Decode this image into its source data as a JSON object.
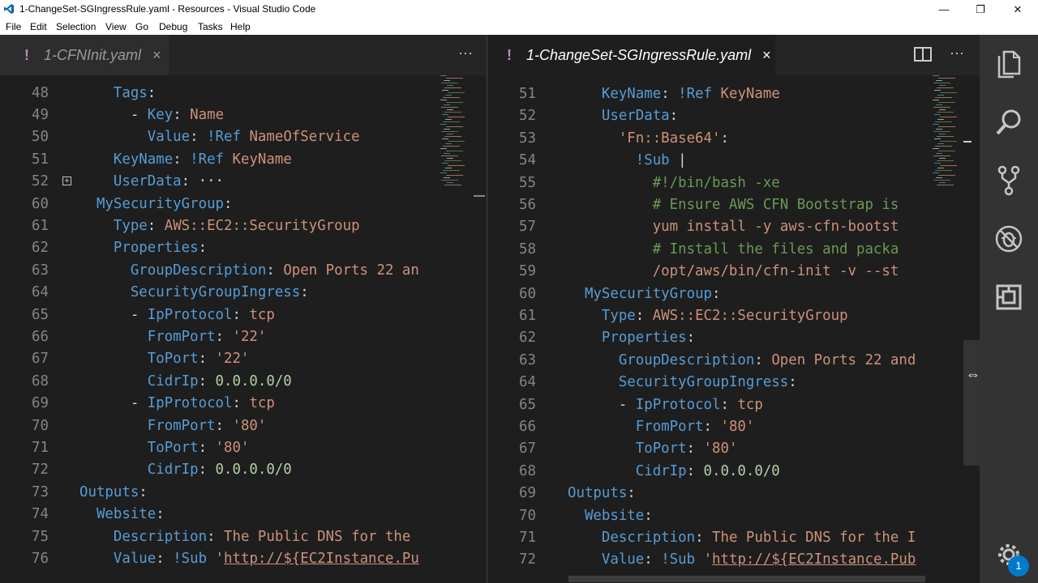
{
  "window": {
    "title": "1-ChangeSet-SGIngressRule.yaml - Resources - Visual Studio Code",
    "minimize": "—",
    "restore": "❐",
    "close": "✕"
  },
  "menu": [
    "File",
    "Edit",
    "Selection",
    "View",
    "Go",
    "Debug",
    "Tasks",
    "Help"
  ],
  "left": {
    "tab": {
      "mod": "!",
      "label": "1-CFNInit.yaml",
      "close": "×"
    },
    "more": "···",
    "lines": [
      {
        "n": "48",
        "t": [
          [
            "    ",
            "p"
          ],
          [
            "Tags",
            "k"
          ],
          [
            ":",
            "p"
          ]
        ]
      },
      {
        "n": "49",
        "t": [
          [
            "      ",
            "p"
          ],
          [
            "- ",
            "p"
          ],
          [
            "Key",
            "k"
          ],
          [
            ": ",
            "p"
          ],
          [
            "Name",
            "s"
          ]
        ]
      },
      {
        "n": "50",
        "t": [
          [
            "        ",
            "p"
          ],
          [
            "Value",
            "k"
          ],
          [
            ": ",
            "p"
          ],
          [
            "!Ref",
            "k"
          ],
          [
            " NameOfService",
            "s"
          ]
        ]
      },
      {
        "n": "51",
        "t": [
          [
            "    ",
            "p"
          ],
          [
            "KeyName",
            "k"
          ],
          [
            ": ",
            "p"
          ],
          [
            "!Ref",
            "k"
          ],
          [
            " KeyName",
            "s"
          ]
        ]
      },
      {
        "n": "52",
        "t": [
          [
            "    ",
            "p"
          ],
          [
            "UserData",
            "k"
          ],
          [
            ":",
            "p"
          ],
          [
            " ···",
            "p"
          ]
        ]
      },
      {
        "n": "60",
        "t": [
          [
            "  ",
            "p"
          ],
          [
            "MySecurityGroup",
            "k"
          ],
          [
            ":",
            "p"
          ]
        ]
      },
      {
        "n": "61",
        "t": [
          [
            "    ",
            "p"
          ],
          [
            "Type",
            "k"
          ],
          [
            ": ",
            "p"
          ],
          [
            "AWS::EC2::SecurityGroup",
            "s"
          ]
        ]
      },
      {
        "n": "62",
        "t": [
          [
            "    ",
            "p"
          ],
          [
            "Properties",
            "k"
          ],
          [
            ":",
            "p"
          ]
        ]
      },
      {
        "n": "63",
        "t": [
          [
            "      ",
            "p"
          ],
          [
            "GroupDescription",
            "k"
          ],
          [
            ": ",
            "p"
          ],
          [
            "Open Ports 22 an",
            "s"
          ]
        ]
      },
      {
        "n": "64",
        "t": [
          [
            "      ",
            "p"
          ],
          [
            "SecurityGroupIngress",
            "k"
          ],
          [
            ":",
            "p"
          ]
        ]
      },
      {
        "n": "65",
        "t": [
          [
            "      ",
            "p"
          ],
          [
            "- ",
            "p"
          ],
          [
            "IpProtocol",
            "k"
          ],
          [
            ": ",
            "p"
          ],
          [
            "tcp",
            "s"
          ]
        ]
      },
      {
        "n": "66",
        "t": [
          [
            "        ",
            "p"
          ],
          [
            "FromPort",
            "k"
          ],
          [
            ": ",
            "p"
          ],
          [
            "'22'",
            "s"
          ]
        ]
      },
      {
        "n": "67",
        "t": [
          [
            "        ",
            "p"
          ],
          [
            "ToPort",
            "k"
          ],
          [
            ": ",
            "p"
          ],
          [
            "'22'",
            "s"
          ]
        ]
      },
      {
        "n": "68",
        "t": [
          [
            "        ",
            "p"
          ],
          [
            "CidrIp",
            "k"
          ],
          [
            ": ",
            "p"
          ],
          [
            "0.0.0.0/0",
            "n"
          ]
        ]
      },
      {
        "n": "69",
        "t": [
          [
            "      ",
            "p"
          ],
          [
            "- ",
            "p"
          ],
          [
            "IpProtocol",
            "k"
          ],
          [
            ": ",
            "p"
          ],
          [
            "tcp",
            "s"
          ]
        ]
      },
      {
        "n": "70",
        "t": [
          [
            "        ",
            "p"
          ],
          [
            "FromPort",
            "k"
          ],
          [
            ": ",
            "p"
          ],
          [
            "'80'",
            "s"
          ]
        ]
      },
      {
        "n": "71",
        "t": [
          [
            "        ",
            "p"
          ],
          [
            "ToPort",
            "k"
          ],
          [
            ": ",
            "p"
          ],
          [
            "'80'",
            "s"
          ]
        ]
      },
      {
        "n": "72",
        "t": [
          [
            "        ",
            "p"
          ],
          [
            "CidrIp",
            "k"
          ],
          [
            ": ",
            "p"
          ],
          [
            "0.0.0.0/0",
            "n"
          ]
        ]
      },
      {
        "n": "73",
        "t": [
          [
            "",
            "p"
          ],
          [
            "Outputs",
            "k"
          ],
          [
            ":",
            "p"
          ]
        ]
      },
      {
        "n": "74",
        "t": [
          [
            "  ",
            "p"
          ],
          [
            "Website",
            "k"
          ],
          [
            ":",
            "p"
          ]
        ]
      },
      {
        "n": "75",
        "t": [
          [
            "    ",
            "p"
          ],
          [
            "Description",
            "k"
          ],
          [
            ": ",
            "p"
          ],
          [
            "The Public DNS for the",
            "s"
          ]
        ]
      },
      {
        "n": "76",
        "t": [
          [
            "    ",
            "p"
          ],
          [
            "Value",
            "k"
          ],
          [
            ": ",
            "p"
          ],
          [
            "!Sub",
            "k"
          ],
          [
            " '",
            "s"
          ],
          [
            "http://${EC2Instance.Pu",
            "u"
          ]
        ]
      }
    ]
  },
  "right": {
    "tab": {
      "mod": "!",
      "label": "1-ChangeSet-SGIngressRule.yaml",
      "close": "×"
    },
    "more": "···",
    "lines": [
      {
        "n": "51",
        "t": [
          [
            "    ",
            "p"
          ],
          [
            "KeyName",
            "k"
          ],
          [
            ": ",
            "p"
          ],
          [
            "!Ref",
            "k"
          ],
          [
            " KeyName",
            "s"
          ]
        ]
      },
      {
        "n": "52",
        "t": [
          [
            "    ",
            "p"
          ],
          [
            "UserData",
            "k"
          ],
          [
            ":",
            "p"
          ]
        ]
      },
      {
        "n": "53",
        "t": [
          [
            "      ",
            "p"
          ],
          [
            "'Fn::Base64'",
            "s"
          ],
          [
            ":",
            "p"
          ]
        ]
      },
      {
        "n": "54",
        "t": [
          [
            "        ",
            "p"
          ],
          [
            "!Sub",
            "k"
          ],
          [
            " |",
            "p"
          ]
        ]
      },
      {
        "n": "55",
        "t": [
          [
            "          ",
            "p"
          ],
          [
            "#!/bin/bash -xe",
            "c"
          ]
        ]
      },
      {
        "n": "56",
        "t": [
          [
            "          ",
            "p"
          ],
          [
            "# Ensure AWS CFN Bootstrap is",
            "c"
          ]
        ]
      },
      {
        "n": "57",
        "t": [
          [
            "          ",
            "p"
          ],
          [
            "yum install -y aws-cfn-bootst",
            "s"
          ]
        ]
      },
      {
        "n": "58",
        "t": [
          [
            "          ",
            "p"
          ],
          [
            "# Install the files and packa",
            "c"
          ]
        ]
      },
      {
        "n": "59",
        "t": [
          [
            "          ",
            "p"
          ],
          [
            "/opt/aws/bin/cfn-init -v --st",
            "s"
          ]
        ]
      },
      {
        "n": "60",
        "t": [
          [
            "  ",
            "p"
          ],
          [
            "MySecurityGroup",
            "k"
          ],
          [
            ":",
            "p"
          ]
        ]
      },
      {
        "n": "61",
        "t": [
          [
            "    ",
            "p"
          ],
          [
            "Type",
            "k"
          ],
          [
            ": ",
            "p"
          ],
          [
            "AWS::EC2::SecurityGroup",
            "s"
          ]
        ]
      },
      {
        "n": "62",
        "t": [
          [
            "    ",
            "p"
          ],
          [
            "Properties",
            "k"
          ],
          [
            ":",
            "p"
          ]
        ]
      },
      {
        "n": "63",
        "t": [
          [
            "      ",
            "p"
          ],
          [
            "GroupDescription",
            "k"
          ],
          [
            ": ",
            "p"
          ],
          [
            "Open Ports 22 and",
            "s"
          ]
        ]
      },
      {
        "n": "64",
        "t": [
          [
            "      ",
            "p"
          ],
          [
            "SecurityGroupIngress",
            "k"
          ],
          [
            ":",
            "p"
          ]
        ]
      },
      {
        "n": "65",
        "t": [
          [
            "      ",
            "p"
          ],
          [
            "- ",
            "p"
          ],
          [
            "IpProtocol",
            "k"
          ],
          [
            ": ",
            "p"
          ],
          [
            "tcp",
            "s"
          ]
        ]
      },
      {
        "n": "66",
        "t": [
          [
            "        ",
            "p"
          ],
          [
            "FromPort",
            "k"
          ],
          [
            ": ",
            "p"
          ],
          [
            "'80'",
            "s"
          ]
        ]
      },
      {
        "n": "67",
        "t": [
          [
            "        ",
            "p"
          ],
          [
            "ToPort",
            "k"
          ],
          [
            ": ",
            "p"
          ],
          [
            "'80'",
            "s"
          ]
        ]
      },
      {
        "n": "68",
        "t": [
          [
            "        ",
            "p"
          ],
          [
            "CidrIp",
            "k"
          ],
          [
            ": ",
            "p"
          ],
          [
            "0.0.0.0/0",
            "n"
          ]
        ]
      },
      {
        "n": "69",
        "t": [
          [
            "",
            "p"
          ],
          [
            "Outputs",
            "k"
          ],
          [
            ":",
            "p"
          ]
        ]
      },
      {
        "n": "70",
        "t": [
          [
            "  ",
            "p"
          ],
          [
            "Website",
            "k"
          ],
          [
            ":",
            "p"
          ]
        ]
      },
      {
        "n": "71",
        "t": [
          [
            "    ",
            "p"
          ],
          [
            "Description",
            "k"
          ],
          [
            ": ",
            "p"
          ],
          [
            "The Public DNS for the I",
            "s"
          ]
        ]
      },
      {
        "n": "72",
        "t": [
          [
            "    ",
            "p"
          ],
          [
            "Value",
            "k"
          ],
          [
            ": ",
            "p"
          ],
          [
            "!Sub",
            "k"
          ],
          [
            " '",
            "s"
          ],
          [
            "http://${EC2Instance.Pub",
            "u"
          ]
        ]
      }
    ]
  },
  "activity": {
    "items": [
      "explorer-icon",
      "search-icon",
      "source-control-icon",
      "debug-icon",
      "extensions-icon",
      "settings-gear-icon"
    ],
    "badge": "1"
  },
  "colors": {
    "editor_bg": "#1e1e1e",
    "key": "#569cd6",
    "string": "#ce9178",
    "number": "#b5cea8",
    "comment": "#6a9955",
    "accent": "#007acc"
  }
}
